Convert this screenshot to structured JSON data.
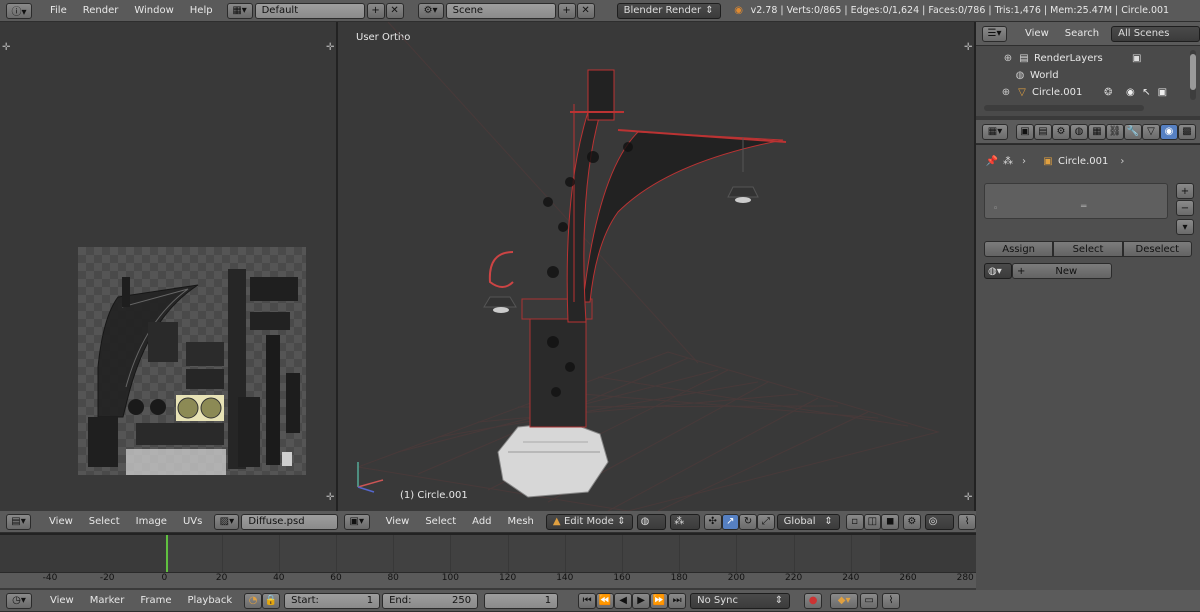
{
  "top": {
    "menus": [
      "File",
      "Render",
      "Window",
      "Help"
    ],
    "screen_layout": "Default",
    "scene": "Scene",
    "engine": "Blender Render",
    "stats": "v2.78 | Verts:0/865 | Edges:0/1,624 | Faces:0/786 | Tris:1,476 | Mem:25.47M | Circle.001"
  },
  "uv": {
    "menus": [
      "View",
      "Select",
      "Image",
      "UVs"
    ],
    "image_name": "Diffuse.psd"
  },
  "viewport": {
    "view_label": "User Ortho",
    "object_label": "(1) Circle.001",
    "menus": [
      "View",
      "Select",
      "Add",
      "Mesh"
    ],
    "mode": "Edit Mode",
    "orientation": "Global"
  },
  "outliner": {
    "menus": [
      "View",
      "Search"
    ],
    "filter": "All Scenes",
    "items": [
      "RenderLayers",
      "World",
      "Circle.001"
    ]
  },
  "properties": {
    "breadcrumb": "Circle.001",
    "buttons": [
      "Assign",
      "Select",
      "Deselect"
    ],
    "new_label": "New"
  },
  "timeline": {
    "ticks": [
      "-40",
      "-20",
      "0",
      "20",
      "40",
      "60",
      "80",
      "100",
      "120",
      "140",
      "160",
      "180",
      "200",
      "220",
      "240",
      "260",
      "280"
    ],
    "menus": [
      "View",
      "Marker",
      "Frame",
      "Playback"
    ],
    "start_label": "Start:",
    "start_value": "1",
    "end_label": "End:",
    "end_value": "250",
    "current_frame": "1",
    "sync": "No Sync"
  },
  "colors": {
    "accent_blue": "#5680c2",
    "selected_edge": "#c0392b",
    "current_frame": "#60c040",
    "ui_bg": "#5b5b5b"
  }
}
